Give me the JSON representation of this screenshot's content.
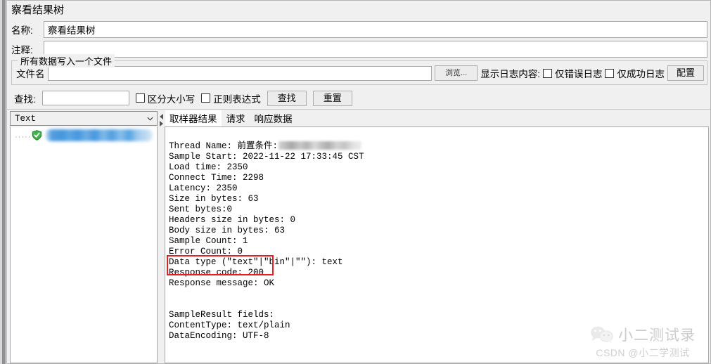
{
  "window": {
    "title": "察看结果树"
  },
  "form": {
    "name_label": "名称:",
    "name_value": "察看结果树",
    "comment_label": "注释:",
    "comment_value": ""
  },
  "file_group": {
    "legend": "所有数据写入一个文件",
    "filename_label": "文件名",
    "filename_value": "",
    "filename_placeholder": "",
    "browse_button": "浏览...",
    "log_display_label": "显示日志内容:",
    "errors_only_label": "仅错误日志",
    "errors_only_checked": false,
    "success_only_label": "仅成功日志",
    "success_only_checked": false,
    "configure_button": "配置"
  },
  "search": {
    "label": "查找:",
    "value": "",
    "placeholder": "",
    "case_sensitive_label": "区分大小写",
    "case_sensitive_checked": false,
    "regex_label": "正则表达式",
    "regex_checked": false,
    "find_button": "查找",
    "reset_button": "重置"
  },
  "left_panel": {
    "renderer_selected": "Text",
    "tree_item_label": "",
    "tree_item_status": "success"
  },
  "tabs": [
    {
      "label": "取样器结果",
      "active": true
    },
    {
      "label": "请求",
      "active": false
    },
    {
      "label": "响应数据",
      "active": false
    }
  ],
  "sampler_result": {
    "thread_name_key": "Thread Name:",
    "thread_name_value": "前置条件:",
    "lines": [
      "Sample Start: 2022-11-22 17:33:45 CST",
      "Load time: 2350",
      "Connect Time: 2298",
      "Latency: 2350",
      "Size in bytes: 63",
      "Sent bytes:0",
      "Headers size in bytes: 0",
      "Body size in bytes: 63",
      "Sample Count: 1",
      "Error Count: 0",
      "Data type (\"text\"|\"bin\"|\"\"): text"
    ],
    "highlighted_lines": [
      "Response code: 200",
      "Response message: OK"
    ],
    "trailing_lines": [
      "",
      "",
      "SampleResult fields:",
      "ContentType: text/plain",
      "DataEncoding: UTF-8"
    ]
  },
  "colors": {
    "highlight_border": "#ee1c1c",
    "panel_bg": "#f0f0f0",
    "field_bg": "#ffffff",
    "selection_blue": "#3e93dd",
    "success_green": "#36b34a"
  },
  "watermark": {
    "name": "小二测试录",
    "subtitle": "CSDN @小二学测试"
  }
}
